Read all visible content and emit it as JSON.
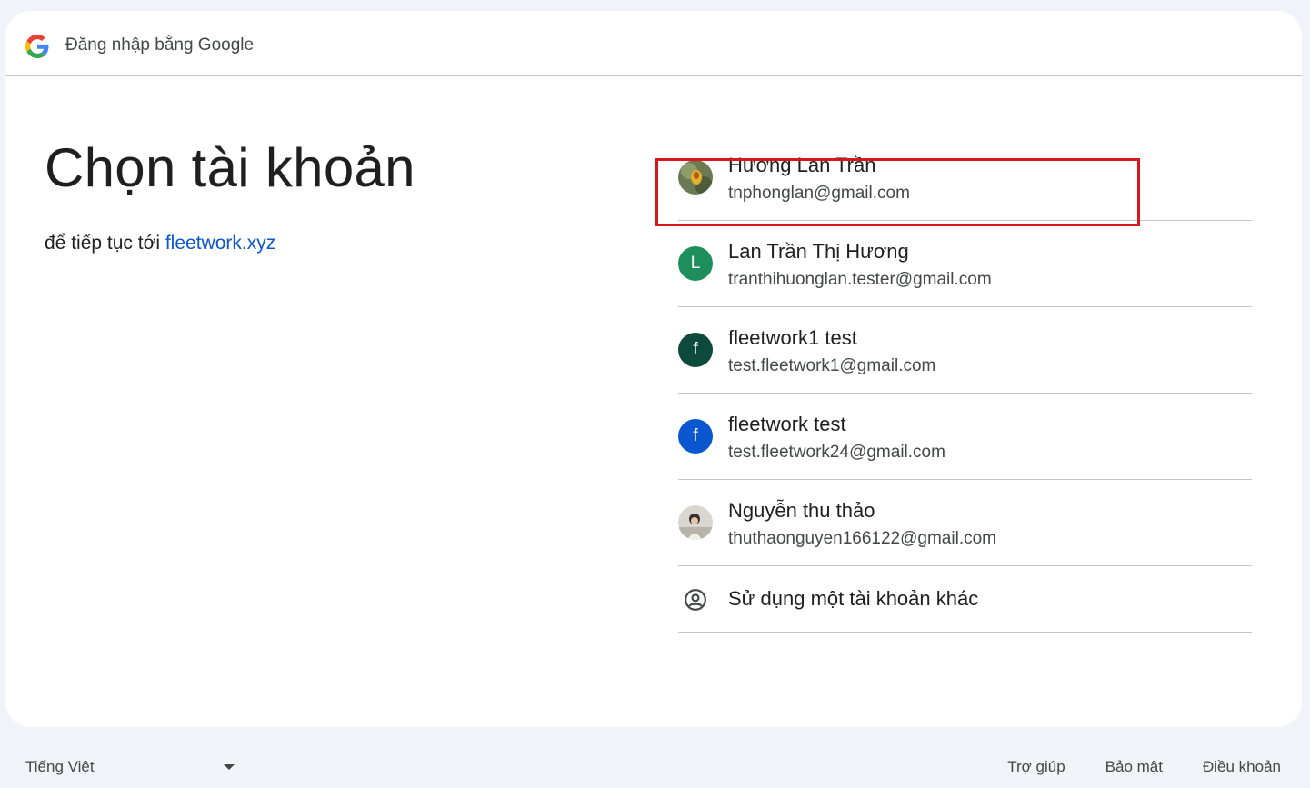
{
  "header": {
    "title": "Đăng nhập bằng Google"
  },
  "main": {
    "title": "Chọn tài khoản",
    "subtitle_prefix": "để tiếp tục tới ",
    "app_name": "fleetwork.xyz"
  },
  "accounts": [
    {
      "name": "Hương Lan Trần",
      "email": "tnphonglan@gmail.com",
      "avatar": "photo-flower"
    },
    {
      "name": "Lan Trần Thị Hương",
      "email": "tranthihuonglan.tester@gmail.com",
      "avatar_letter": "L",
      "avatar_color": "#1e8e5c"
    },
    {
      "name": "fleetwork1 test",
      "email": "test.fleetwork1@gmail.com",
      "avatar_letter": "f",
      "avatar_color": "#0d4a3b"
    },
    {
      "name": "fleetwork test",
      "email": "test.fleetwork24@gmail.com",
      "avatar_letter": "f",
      "avatar_color": "#0b57d0"
    },
    {
      "name": "Nguyễn thu thảo",
      "email": "thuthaonguyen166122@gmail.com",
      "avatar": "photo-person"
    }
  ],
  "other_account": {
    "label": "Sử dụng một tài khoản khác",
    "icon": "account-circle-icon"
  },
  "footer": {
    "language": "Tiếng Việt",
    "help": "Trợ giúp",
    "privacy": "Bảo mật",
    "terms": "Điều khoản"
  },
  "colors": {
    "link": "#0b57d0",
    "highlight_box": "#d9161c",
    "background": "#f0f4f9"
  }
}
